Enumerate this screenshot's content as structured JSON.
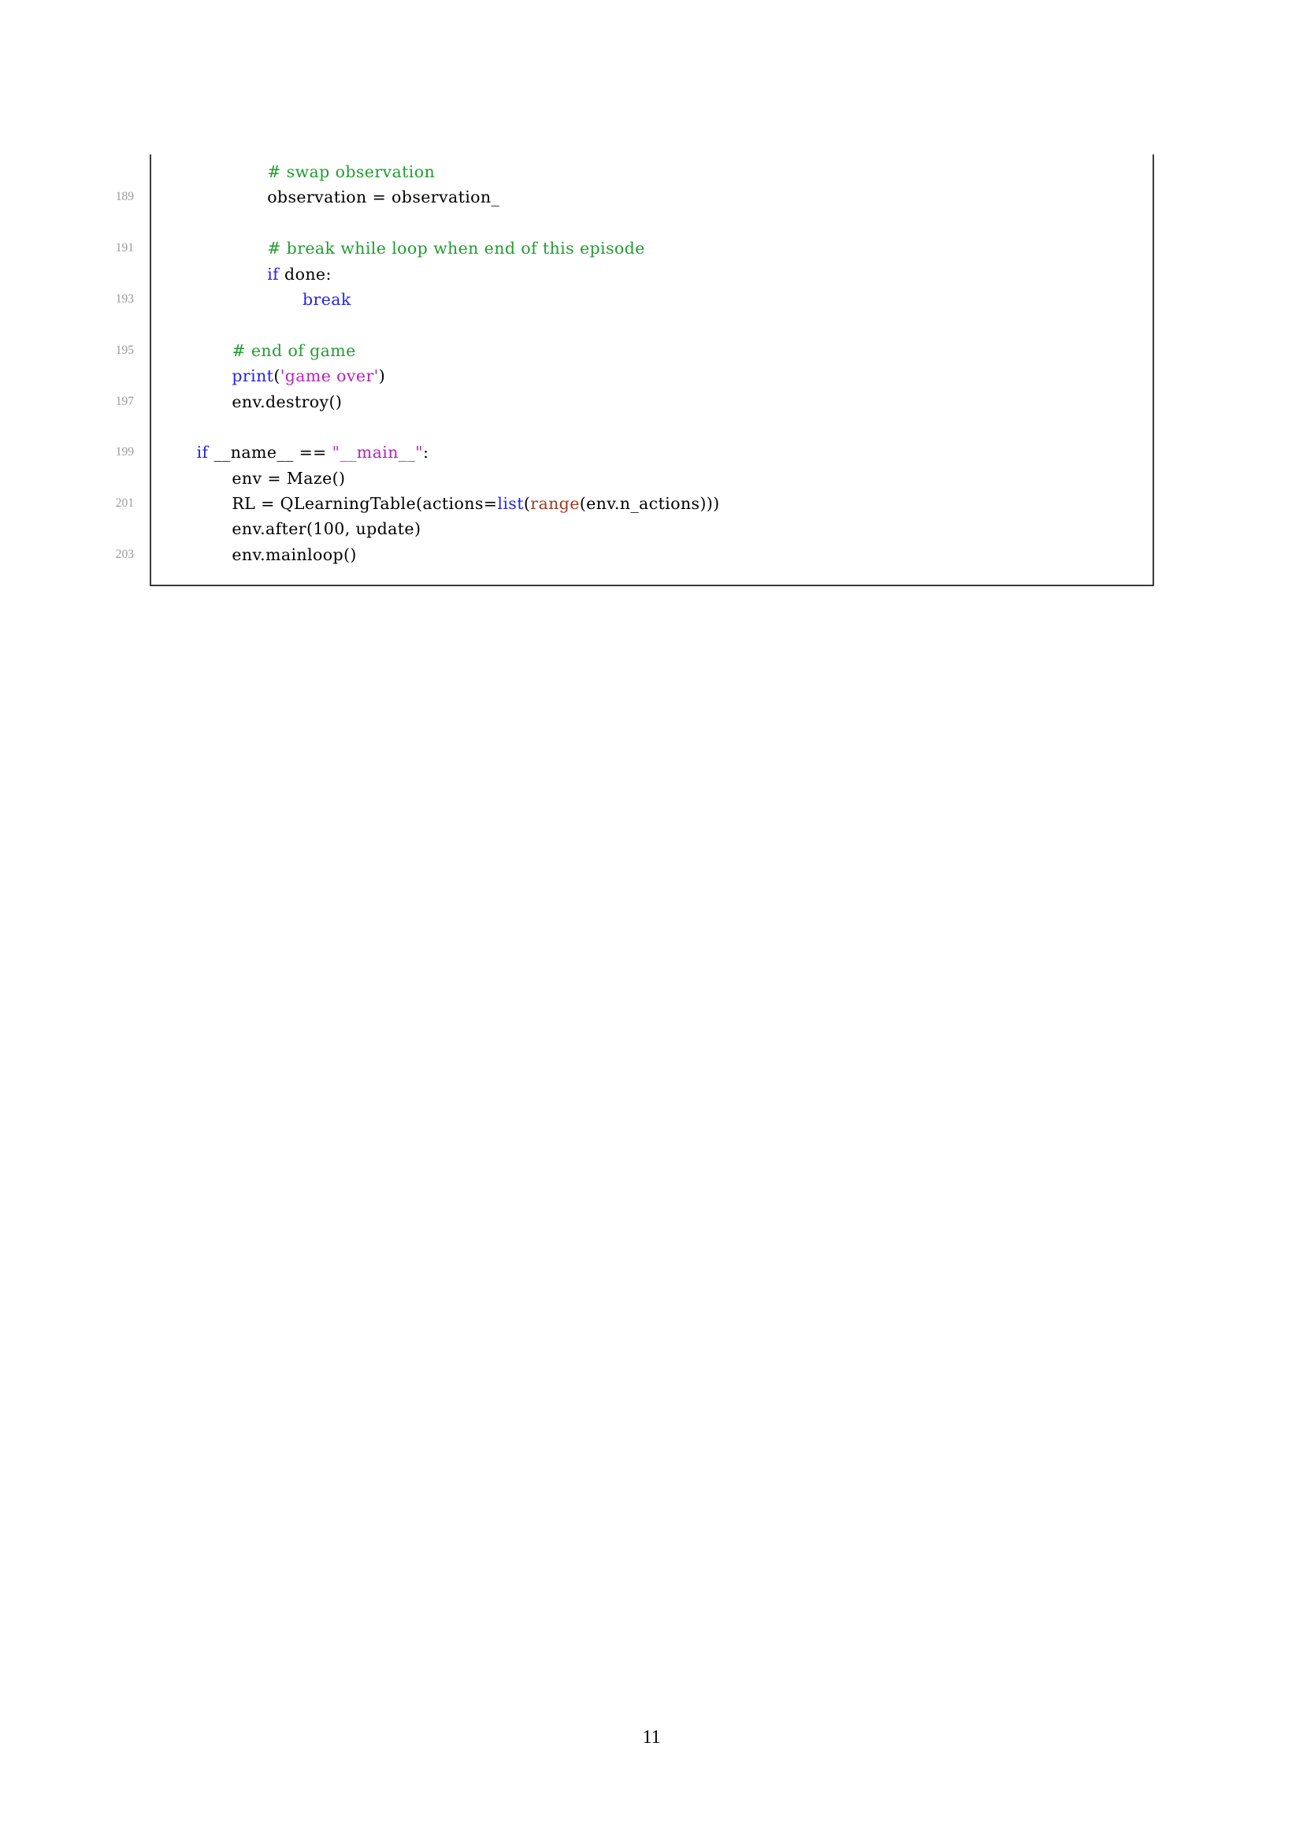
{
  "document": {
    "page_number": "11",
    "colors": {
      "comment": "#1f9e2f",
      "keyword": "#2424e8",
      "string": "#b625b6",
      "builtin_range": "#a03a20",
      "line_number": "#9a9a9a",
      "frame_border": "#3b3b3b",
      "text": "#000000",
      "background": "#ffffff"
    }
  },
  "listing": {
    "language": "Python",
    "lines": [
      {
        "number": "",
        "indent": 11,
        "tokens": [
          {
            "text": "# swap observation",
            "type": "comment"
          }
        ]
      },
      {
        "number": "189",
        "indent": 11,
        "tokens": [
          {
            "text": "observation = observation_",
            "type": "plain"
          }
        ]
      },
      {
        "number": "",
        "indent": 0,
        "tokens": []
      },
      {
        "number": "191",
        "indent": 11,
        "tokens": [
          {
            "text": "# break while loop when end of this episode",
            "type": "comment"
          }
        ]
      },
      {
        "number": "",
        "indent": 11,
        "tokens": [
          {
            "text": "if",
            "type": "keyword"
          },
          {
            "text": " done:",
            "type": "plain"
          }
        ]
      },
      {
        "number": "193",
        "indent": 15,
        "tokens": [
          {
            "text": "break",
            "type": "keyword"
          }
        ]
      },
      {
        "number": "",
        "indent": 0,
        "tokens": []
      },
      {
        "number": "195",
        "indent": 7,
        "tokens": [
          {
            "text": "# end of game",
            "type": "comment"
          }
        ]
      },
      {
        "number": "",
        "indent": 7,
        "tokens": [
          {
            "text": "print",
            "type": "keyword"
          },
          {
            "text": "(",
            "type": "plain"
          },
          {
            "text": "'game over'",
            "type": "string"
          },
          {
            "text": ")",
            "type": "plain"
          }
        ]
      },
      {
        "number": "197",
        "indent": 7,
        "tokens": [
          {
            "text": "env.destroy()",
            "type": "plain"
          }
        ]
      },
      {
        "number": "",
        "indent": 0,
        "tokens": []
      },
      {
        "number": "199",
        "indent": 3,
        "tokens": [
          {
            "text": "if",
            "type": "keyword"
          },
          {
            "text": " __name__ == ",
            "type": "plain"
          },
          {
            "text": "\"__main__\"",
            "type": "string"
          },
          {
            "text": ":",
            "type": "plain"
          }
        ]
      },
      {
        "number": "",
        "indent": 7,
        "tokens": [
          {
            "text": "env = Maze()",
            "type": "plain"
          }
        ]
      },
      {
        "number": "201",
        "indent": 7,
        "tokens": [
          {
            "text": "RL = QLearningTable(actions=",
            "type": "plain"
          },
          {
            "text": "list",
            "type": "keyword"
          },
          {
            "text": "(",
            "type": "plain"
          },
          {
            "text": "range",
            "type": "range"
          },
          {
            "text": "(env.n_actions)))",
            "type": "plain"
          }
        ]
      },
      {
        "number": "",
        "indent": 7,
        "tokens": [
          {
            "text": "env.after(100, update)",
            "type": "plain"
          }
        ]
      },
      {
        "number": "203",
        "indent": 7,
        "tokens": [
          {
            "text": "env.mainloop()",
            "type": "plain"
          }
        ]
      }
    ]
  }
}
